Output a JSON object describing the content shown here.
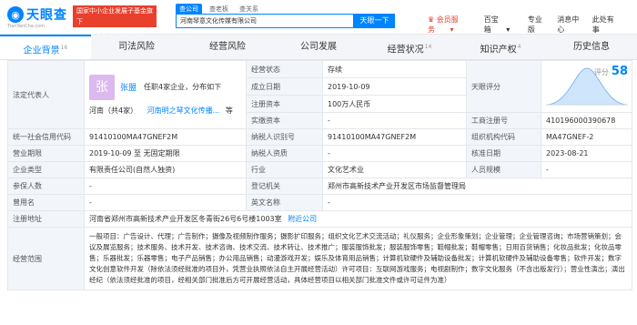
{
  "header": {
    "logo_text": "天眼查",
    "logo_sub": "TianYanCha.com",
    "promo_line1": "国家中小企业发展子基金旗下",
    "promo_line2": "官方备案企业征信机构",
    "search_tabs": [
      "查公司",
      "查老板",
      "查关系"
    ],
    "search_value": "河南琴意文化传媒有限公司",
    "search_button": "天眼一下",
    "vip": "会员服务",
    "baixiang": "百宝箱",
    "pro": "专业版",
    "msg": "消息中心",
    "user": "此处有事"
  },
  "tabs": [
    {
      "label": "企业背景",
      "count": "16",
      "active": true
    },
    {
      "label": "司法风险",
      "count": "",
      "active": false
    },
    {
      "label": "经营风险",
      "count": "",
      "active": false
    },
    {
      "label": "公司发展",
      "count": "",
      "active": false
    },
    {
      "label": "经营状况",
      "count": "14",
      "active": false
    },
    {
      "label": "知识产权",
      "count": "4",
      "active": false
    },
    {
      "label": "历史信息",
      "count": "",
      "active": false
    }
  ],
  "info": {
    "legal_label": "法定代表人",
    "avatar_char": "张",
    "legal_name": "张盟",
    "legal_desc": "任职4家企业，分布如下",
    "legal_region": "河南（共4家）",
    "legal_company": "河南明之琴文化传播...",
    "legal_more": "等",
    "status_label": "经营状态",
    "status": "存续",
    "tianyan_label": "天眼评分",
    "score_label": "评分",
    "score": "58",
    "found_label": "成立日期",
    "found": "2019-10-09",
    "regcap_label": "注册资本",
    "regcap": "100万人民币",
    "paidcap_label": "实缴资本",
    "paidcap": "-",
    "bizreg_label": "工商注册号",
    "bizreg": "410196000390678",
    "credit_label": "统一社会信用代码",
    "credit": "91410100MA47GNEF2M",
    "taxid_label": "纳税人识别号",
    "taxid": "91410100MA47GNEF2M",
    "org_label": "组织机构代码",
    "org": "MA47GNEF-2",
    "term_label": "营业期限",
    "term": "2019-10-09 至 无固定期限",
    "taxq_label": "纳税人资质",
    "taxq": "-",
    "approve_label": "核准日期",
    "approve": "2023-08-21",
    "type_label": "企业类型",
    "type": "有限责任公司(自然人独资)",
    "industry_label": "行业",
    "industry": "文化艺术业",
    "staff_label": "人员规模",
    "staff": "-",
    "insured_label": "参保人数",
    "insured": "-",
    "authority_label": "登记机关",
    "authority": "郑州市高新技术产业开发区市场监督管理局",
    "former_label": "曾用名",
    "former": "-",
    "en_label": "英文名称",
    "en": "-",
    "addr_label": "注册地址",
    "addr": "河南省郑州市高新技术产业开发区冬青街26号6号楼1003室",
    "addr_link": "附近公司",
    "scope_label": "经营范围",
    "scope": "一般项目：广告设计、代理；广告制作；摄像及视频制作服务；摄影扩印服务；组织文化艺术交流活动；礼仪服务；企业形象策划；企业管理；企业管理咨询；市场营销策划；会议及展览服务；技术服务、技术开发、技术咨询、技术交流、技术转让、技术推广；服装服饰批发；服装服饰零售；鞋帽批发；鞋帽零售；日用百货销售；化妆品批发；化妆品零售；乐器批发；乐器零售；电子产品销售；办公用品销售；动漫游戏开发；娱乐及体育用品销售；计算机软硬件及辅助设备批发；计算机软硬件及辅助设备零售；软件开发；数字文化创意软件开发（除依法须经批准的项目外，凭营业执照依法自主开展经营活动）许可项目：互联网游戏服务；电视剧制作；数字文化服务（不含出版发行）；营业性演出；演出经纪（依法须经批准的项目，经相关部门批准后方可开展经营活动，具体经营项目以相关部门批准文件或许可证件为准）"
  }
}
